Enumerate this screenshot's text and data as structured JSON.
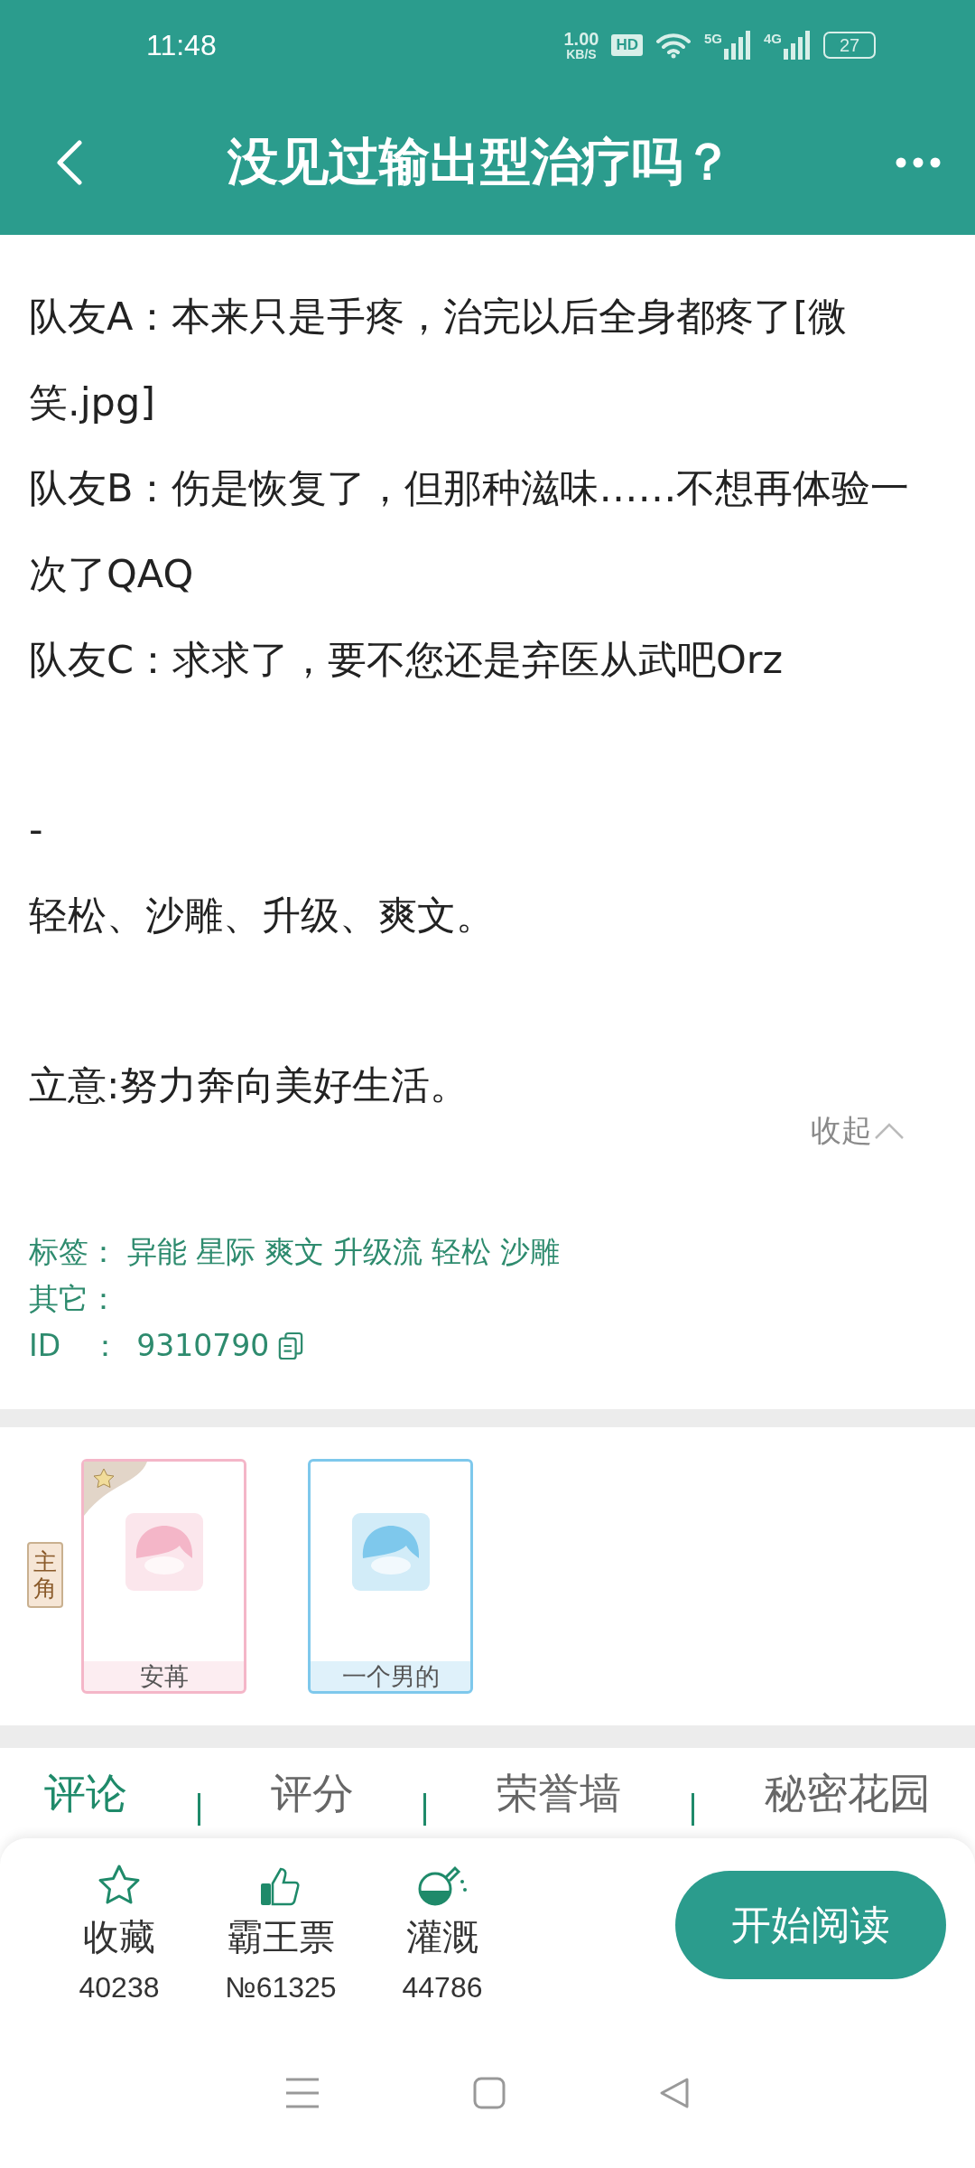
{
  "status_bar": {
    "time": "11:48",
    "speed_value": "1.00",
    "speed_unit": "KB/S",
    "hd": "HD",
    "networks": [
      "5G",
      "4G"
    ],
    "battery": "27"
  },
  "header": {
    "title": "没见过输出型治疗吗？"
  },
  "synopsis": [
    [
      "队友A：本来只是手疼，治完以后全身都疼了[微笑.jpg]",
      "队友B：伤是恢复了，但那种滋味……不想再体验一次了QAQ",
      "队友C：求求了，要不您还是弃医从武吧Orz"
    ],
    [
      "-",
      "轻松、沙雕、升级、爽文。"
    ],
    [
      "立意:努力奔向美好生活。"
    ]
  ],
  "collapse_label": "收起",
  "meta": {
    "tags_label": "标签：",
    "tags": [
      "异能",
      "星际",
      "爽文",
      "升级流",
      "轻松",
      "沙雕"
    ],
    "other_label": "其它：",
    "id_label": "ID　：",
    "id": "9310790"
  },
  "characters": {
    "badge": "主角",
    "items": [
      {
        "name": "安苒",
        "color": "#f4b6c8",
        "protagonist": true
      },
      {
        "name": "一个男的",
        "color": "#7ec8ec",
        "protagonist": false
      }
    ]
  },
  "tabs": [
    {
      "label": "评论",
      "selected": true
    },
    {
      "label": "评分",
      "selected": false
    },
    {
      "label": "荣誉墙",
      "selected": false
    },
    {
      "label": "秘密花园",
      "selected": false
    }
  ],
  "stats": [
    {
      "kind": "star",
      "label": "收藏",
      "value": "40238"
    },
    {
      "kind": "thumb",
      "label": "霸王票",
      "value": "№61325"
    },
    {
      "kind": "flask",
      "label": "灌溉",
      "value": "44786"
    }
  ],
  "read_button": "开始阅读"
}
